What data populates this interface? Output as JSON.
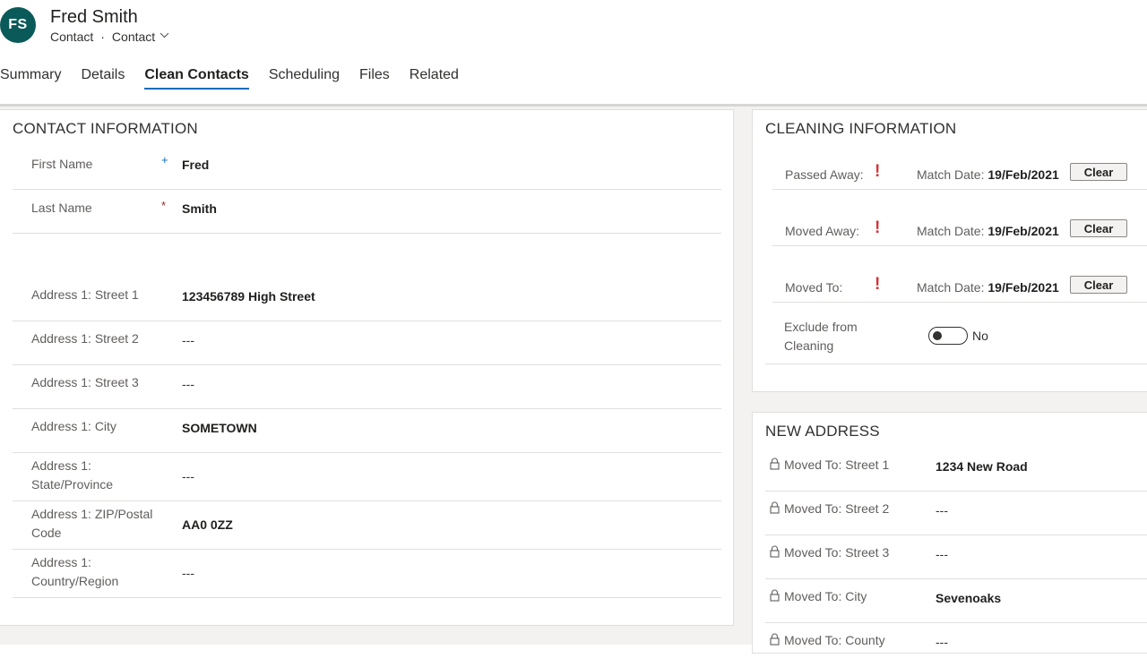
{
  "header": {
    "initials": "FS",
    "name": "Fred Smith",
    "entity": "Contact",
    "form": "Contact"
  },
  "tabs": [
    {
      "label": "Summary"
    },
    {
      "label": "Details"
    },
    {
      "label": "Clean Contacts"
    },
    {
      "label": "Scheduling"
    },
    {
      "label": "Files"
    },
    {
      "label": "Related"
    }
  ],
  "active_tab": "Clean Contacts",
  "contact": {
    "title": "CONTACT INFORMATION",
    "first_name": {
      "label": "First Name",
      "required": "+",
      "value": "Fred"
    },
    "last_name": {
      "label": "Last Name",
      "required": "*",
      "value": "Smith"
    },
    "street1": {
      "label": "Address 1: Street 1",
      "value": "123456789 High Street"
    },
    "street2": {
      "label": "Address 1: Street 2",
      "value": "---"
    },
    "street3": {
      "label": "Address 1: Street 3",
      "value": "---"
    },
    "city": {
      "label": "Address 1: City",
      "value": "SOMETOWN"
    },
    "state": {
      "label_line1": "Address 1:",
      "label_line2": "State/Province",
      "value": "---"
    },
    "zip": {
      "label_line1": "Address 1: ZIP/Postal",
      "label_line2": "Code",
      "value": "AA0 0ZZ"
    },
    "country": {
      "label_line1": "Address 1:",
      "label_line2": "Country/Region",
      "value": "---"
    }
  },
  "cleaning": {
    "title": "CLEANING INFORMATION",
    "rows": [
      {
        "label": "Passed Away:",
        "flag": "!",
        "match_label": "Match Date:",
        "match_date": "19/Feb/2021",
        "button": "Clear"
      },
      {
        "label": "Moved Away:",
        "flag": "!",
        "match_label": "Match Date:",
        "match_date": "19/Feb/2021",
        "button": "Clear"
      },
      {
        "label": "Moved To:",
        "flag": "!",
        "match_label": "Match Date:",
        "match_date": "19/Feb/2021",
        "button": "Clear"
      }
    ],
    "exclude_label_line1": "Exclude from",
    "exclude_label_line2": "Cleaning",
    "exclude_value": "No",
    "exclude_on": false
  },
  "new_address": {
    "title": "NEW ADDRESS",
    "rows": [
      {
        "label": "Moved To: Street 1",
        "value": "1234 New Road"
      },
      {
        "label": "Moved To: Street 2",
        "value": "---"
      },
      {
        "label": "Moved To: Street 3",
        "value": "---"
      },
      {
        "label": "Moved To: City",
        "value": "Sevenoaks"
      },
      {
        "label": "Moved To: County",
        "value": "---"
      }
    ]
  }
}
